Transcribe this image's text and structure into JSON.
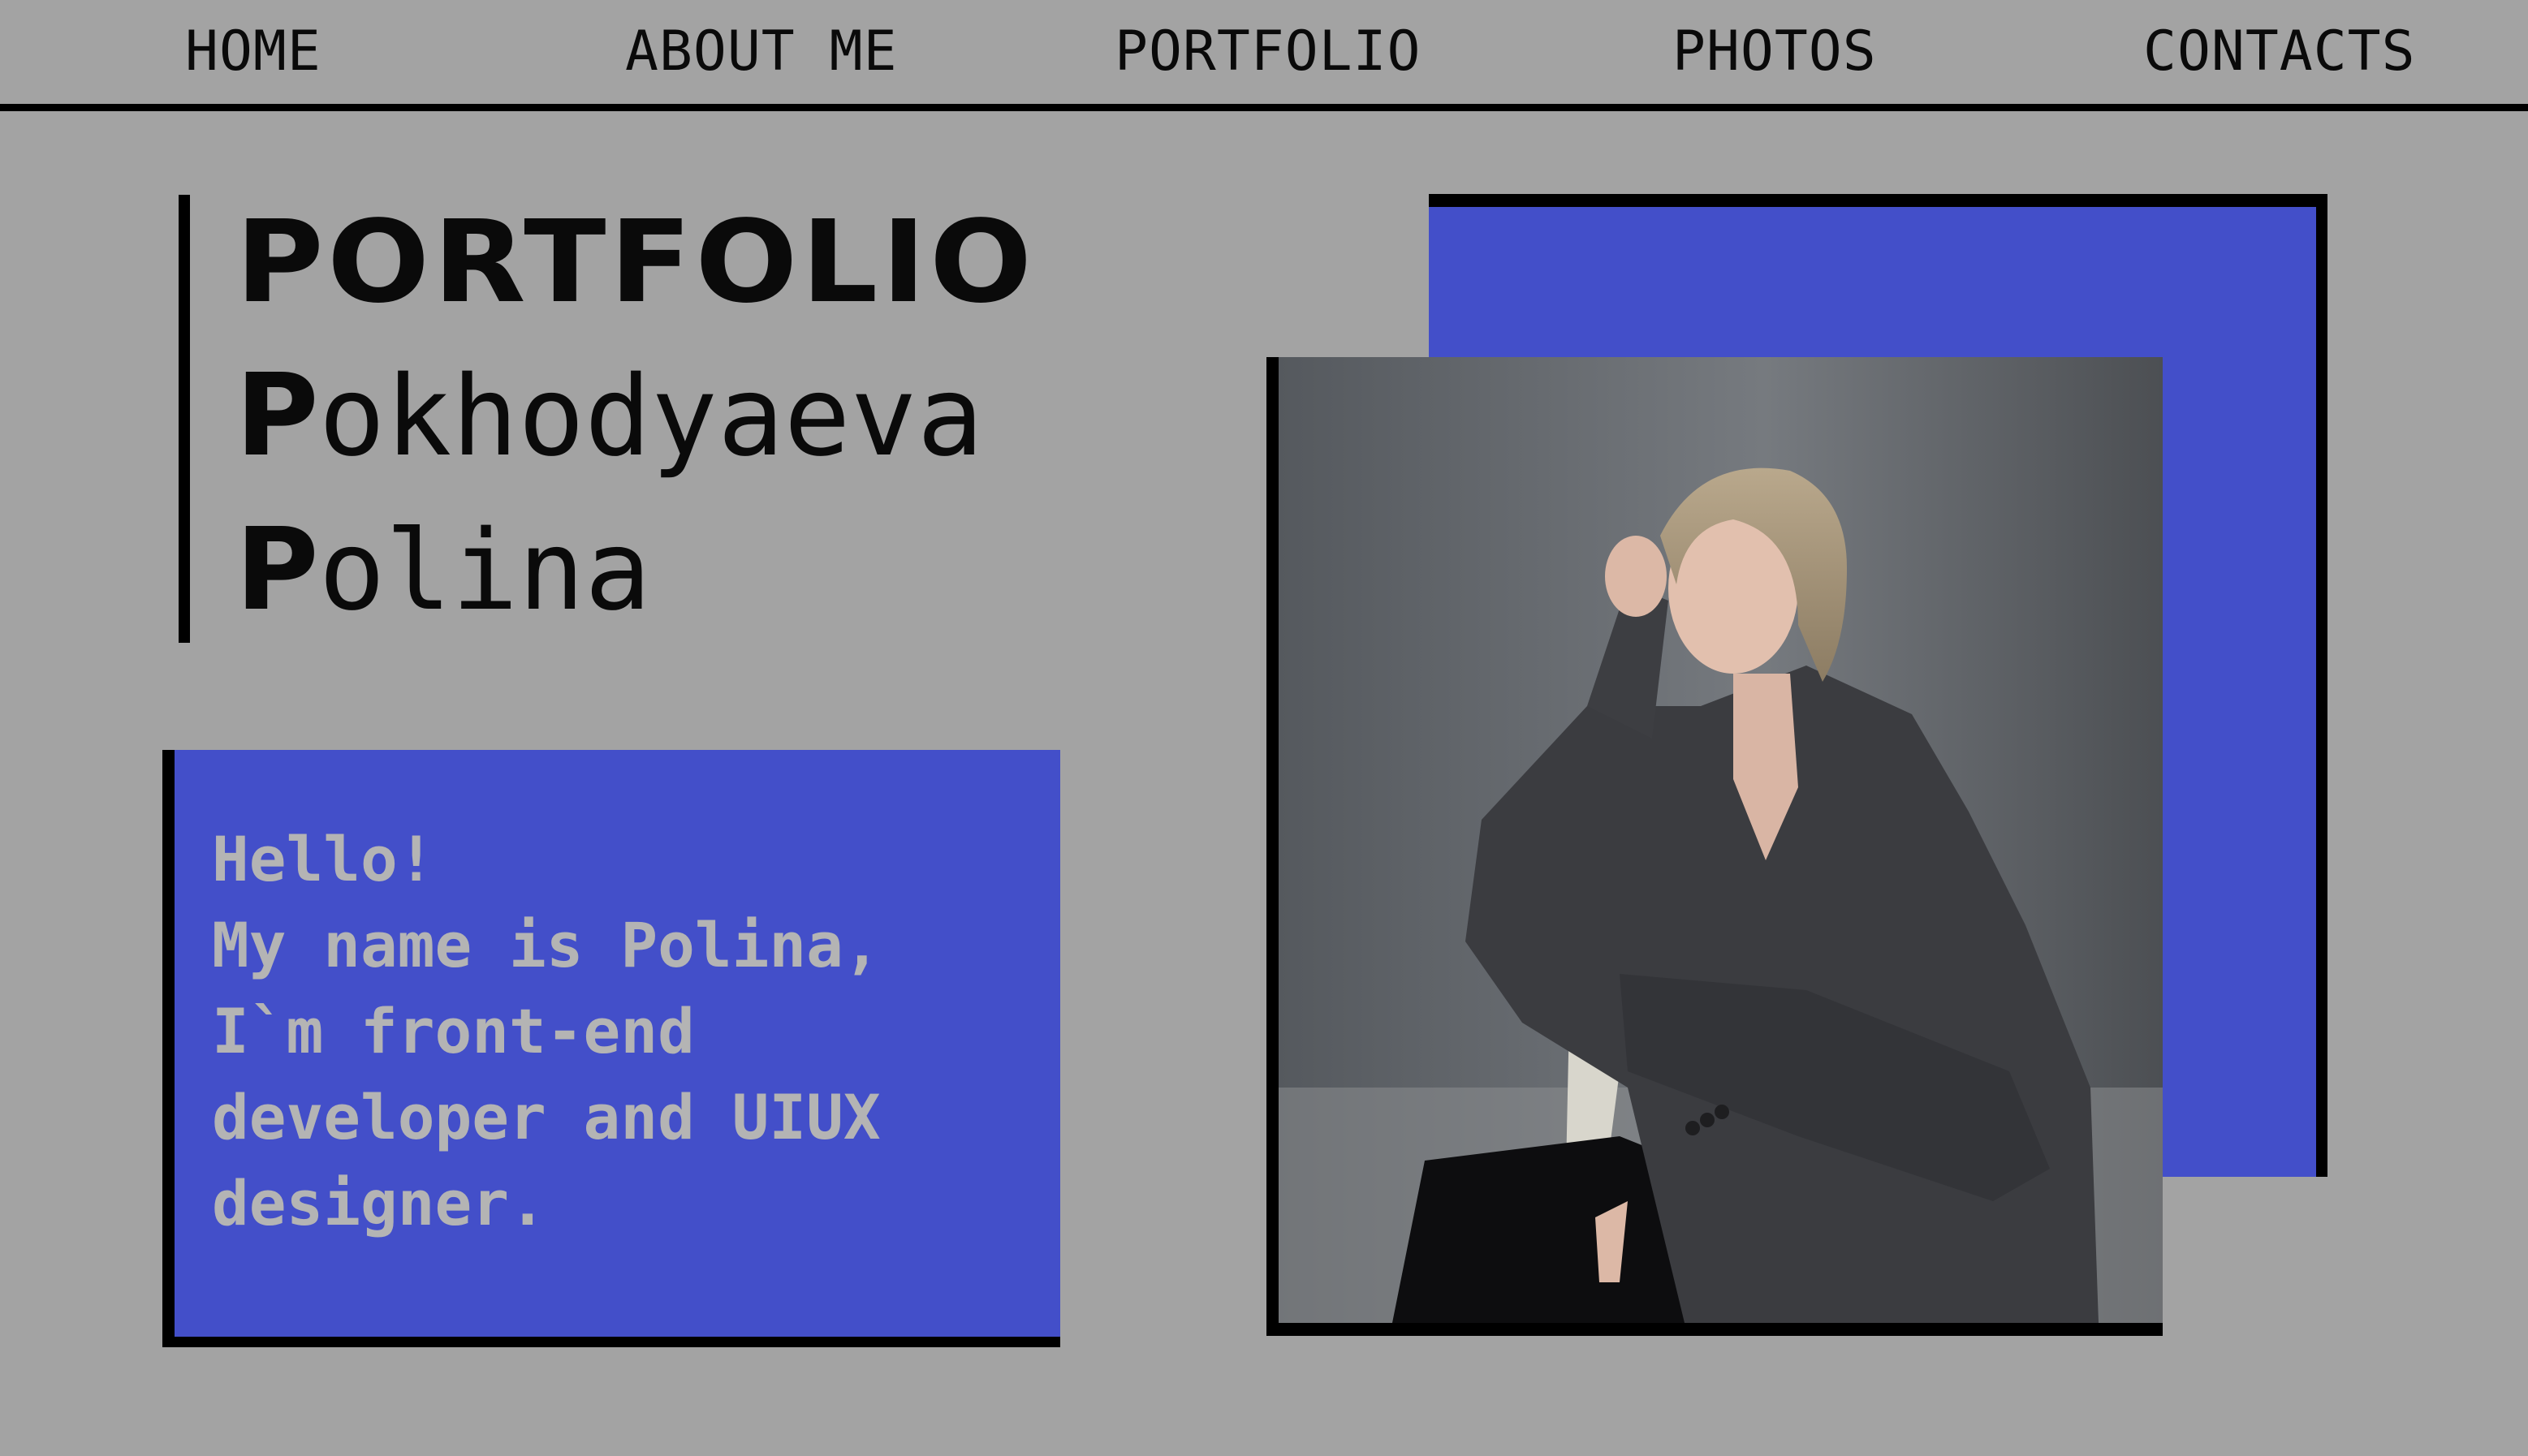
{
  "nav": {
    "items": [
      {
        "label": "HOME"
      },
      {
        "label": "ABOUT ME"
      },
      {
        "label": "PORTFOLIO"
      },
      {
        "label": "PHOTOS"
      },
      {
        "label": "CONTACTS"
      }
    ]
  },
  "hero": {
    "title": "PORTFOLIO",
    "surname_initial": "P",
    "surname_rest": "okhodyaeva",
    "firstname_initial": "P",
    "firstname_rest": "olina"
  },
  "intro": {
    "lines": [
      "Hello!",
      "My name is Polina,",
      "I`m front-end",
      "developer and UIUX",
      "designer."
    ]
  },
  "colors": {
    "background": "#a3a3a3",
    "accent_blue": "#434fc9",
    "intro_text": "#b4b4b4",
    "black": "#000000"
  },
  "photo": {
    "icon": "portrait-photo"
  }
}
